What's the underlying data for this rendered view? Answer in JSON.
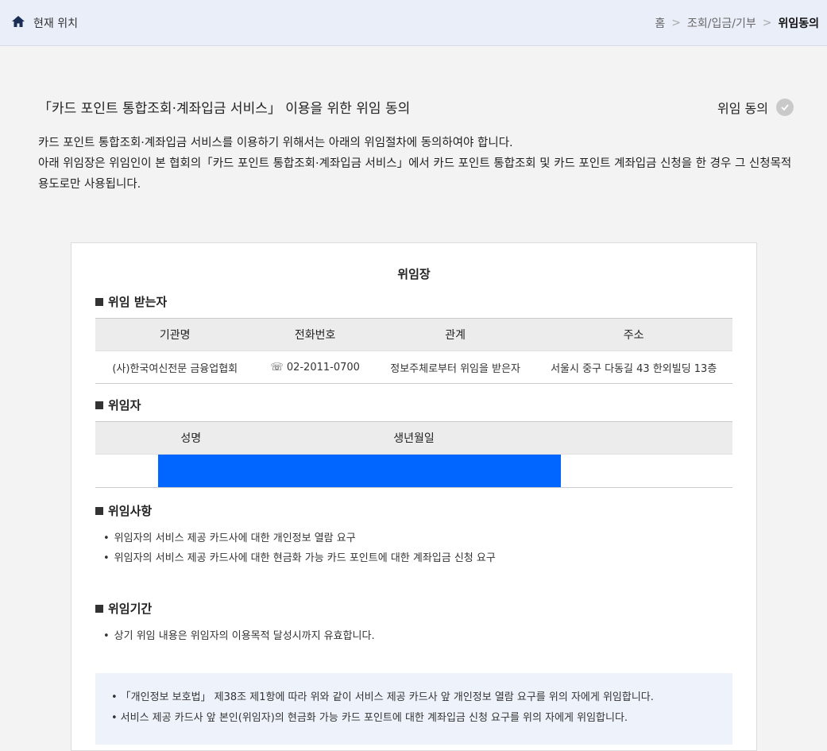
{
  "header": {
    "location_label": "현재 위치",
    "breadcrumb": [
      "홈",
      "조회/입금/기부",
      "위임동의"
    ]
  },
  "intro": {
    "title": "「카드 포인트 통합조회·계좌입금 서비스」 이용을 위한 위임 동의",
    "consent_label": "위임 동의",
    "desc_line1": "카드 포인트 통합조회·계좌입금 서비스를 이용하기 위해서는 아래의 위임절차에 동의하여야 합니다.",
    "desc_line2": "아래 위임장은 위임인이 본 협회의「카드 포인트 통합조회·계좌입금 서비스」에서 카드 포인트 통합조회 및 카드 포인트 계좌입금 신청을 한 경우 그 신청목적 용도로만 사용됩니다."
  },
  "card": {
    "title": "위임장",
    "receiver": {
      "heading": "위임 받는자",
      "columns": [
        "기관명",
        "전화번호",
        "관계",
        "주소"
      ],
      "row": [
        "(사)한국여신전문 금융업협회",
        "☏ 02-2011-0700",
        "정보주체로부터 위임을 받은자",
        "서울시 중구 다동길 43 한외빌딩 13층"
      ]
    },
    "delegator": {
      "heading": "위임자",
      "columns": [
        "성명",
        "생년월일"
      ]
    },
    "matters": {
      "heading": "위임사항",
      "items": [
        "위임자의 서비스 제공 카드사에 대한 개인정보 열람 요구",
        "위임자의 서비스 제공 카드사에 대한 현금화 가능 카드 포인트에 대한 계좌입금 신청 요구"
      ]
    },
    "period": {
      "heading": "위임기간",
      "items": [
        "상기 위임 내용은 위임자의 이용목적 달성시까지 유효합니다."
      ]
    },
    "notice": [
      "「개인정보 보호법」 제38조 제1항에 따라 위와 같이 서비스 제공 카드사 앞 개인정보 열람 요구를 위의 자에게 위임합니다.",
      "서비스 제공 카드사 앞 본인(위임자)의 현금화 가능 카드 포인트에 대한 계좌입금 신청 요구를 위의 자에게 위임합니다."
    ]
  },
  "colors": {
    "highlight": "#0066ff",
    "topbar": "#e9eef9"
  }
}
